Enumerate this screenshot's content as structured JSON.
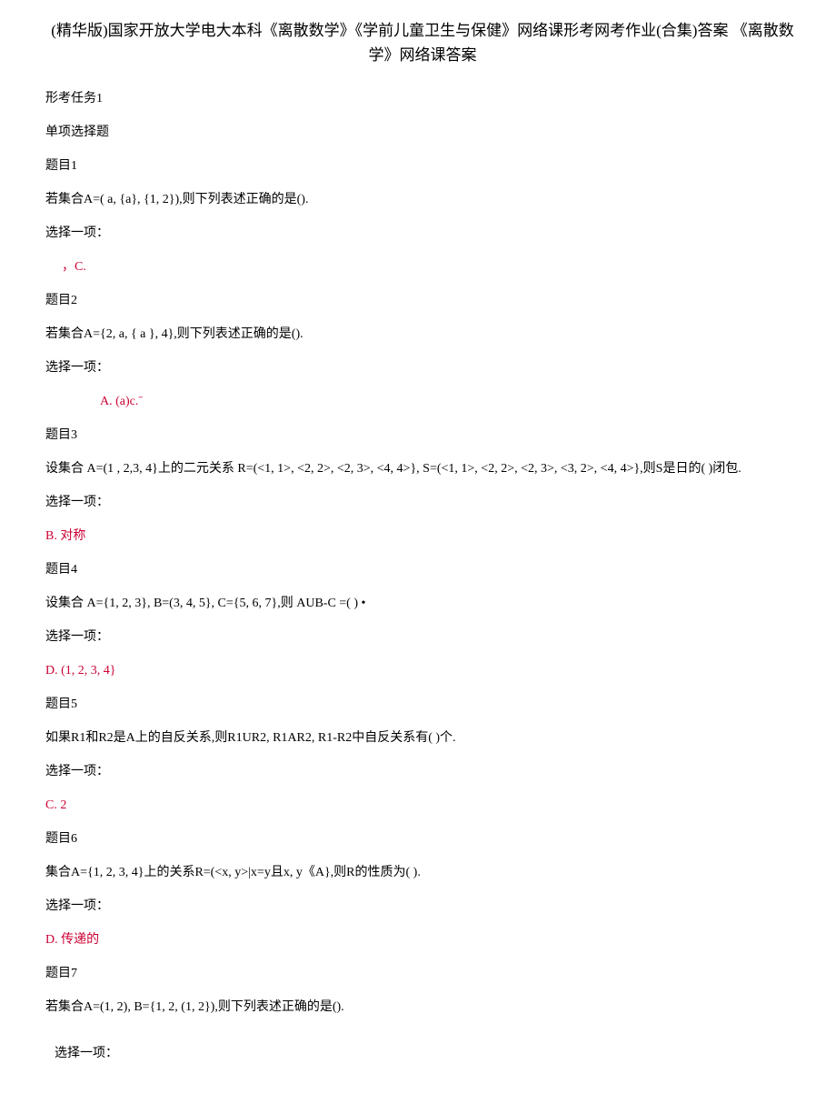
{
  "title": "(精华版)国家开放大学电大本科《离散数学》《学前儿童卫生与保健》网络课形考网考作业(合集)答案 《离散数学》网络课答案",
  "task_heading": "形考任务1",
  "section_heading": "单项选择题",
  "select_prompt": "选择一项：",
  "questions": [
    {
      "label": "题目1",
      "text": "若集合A=( a, {a}, {1, 2}),则下列表述正确的是().",
      "answer": "，C.",
      "answer_class": "answer-indent1"
    },
    {
      "label": "题目2",
      "text": "若集合A={2, a, { a }, 4},则下列表述正确的是().",
      "answer": "A. (a)c.ˉ",
      "answer_class": "answer-indent2"
    },
    {
      "label": "题目3",
      "text": "设集合 A=(1 , 2,3, 4}上的二元关系 R=(<1, 1>, <2, 2>, <2, 3>, <4, 4>}, S=(<1, 1>, <2, 2>, <2, 3>, <3, 2>, <4, 4>},则S是日的(        )闭包.",
      "answer": "B. 对称"
    },
    {
      "label": "题目4",
      "text": "设集合 A={1, 2, 3}, B=(3, 4, 5}, C={5, 6, 7},则 AUB-C =(      ) •",
      "answer": "D. (1, 2, 3, 4}"
    },
    {
      "label": "题目5",
      "text": "如果R1和R2是A上的自反关系,则R1UR2, R1AR2, R1-R2中自反关系有(             )个.",
      "answer": "C. 2"
    },
    {
      "label": "题目6",
      "text": "集合A={1, 2, 3, 4}上的关系R=(<x, y>|x=y且x, y《A},则R的性质为(           ).",
      "answer": "D. 传递的"
    },
    {
      "label": "题目7",
      "text": "若集合A=(1, 2), B={1, 2, (1, 2}),则下列表述正确的是().",
      "answer": ""
    }
  ]
}
